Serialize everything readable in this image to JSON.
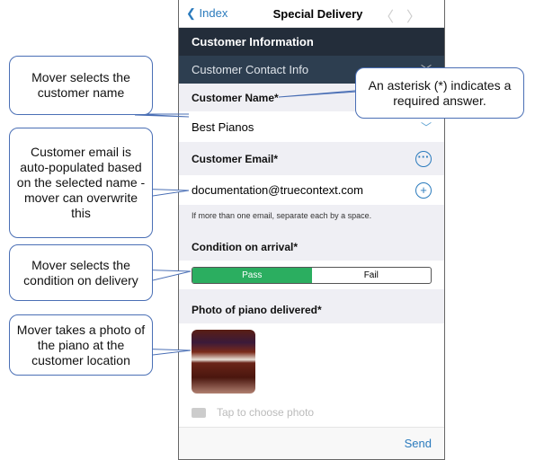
{
  "nav": {
    "back_label": "Index",
    "title": "Special Delivery",
    "prev_icon": "chevron-left",
    "next_icon": "chevron-right"
  },
  "section": {
    "title": "Customer Information",
    "subsection": "Customer Contact Info"
  },
  "fields": {
    "name": {
      "label": "Customer Name*",
      "value": "Best Pianos"
    },
    "email": {
      "label": "Customer Email*",
      "value": "documentation@truecontext.com",
      "hint": "If more than one email, separate each by a space."
    },
    "condition": {
      "label": "Condition on arrival*",
      "options": [
        "Pass",
        "Fail"
      ],
      "selected": "Pass"
    },
    "photo": {
      "label": "Photo of piano delivered*",
      "placeholder": "Tap to choose photo"
    }
  },
  "footer": {
    "send_label": "Send"
  },
  "callouts": {
    "name": "Mover selects the customer name",
    "email": "Customer email is auto-populated based on the selected name - mover can overwrite this",
    "condition": "Mover selects the condition on delivery",
    "photo": "Mover takes a photo of the piano at the customer location",
    "asterisk": "An asterisk (*) indicates a required answer."
  },
  "colors": {
    "accent": "#2b7bbd",
    "pass": "#2bae60",
    "header": "#232d3a"
  }
}
